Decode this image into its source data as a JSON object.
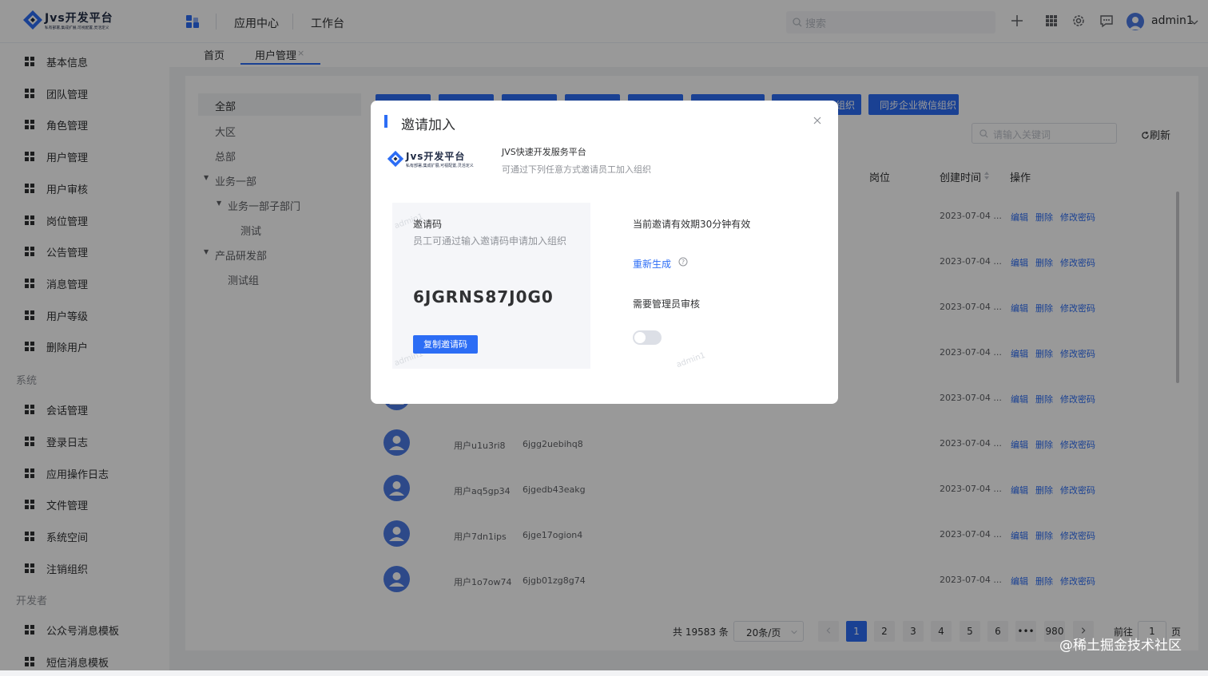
{
  "header": {
    "logo_title": "Jvs开发平台",
    "logo_sub": "私有部署,集成扩展,可视配置,灵活定义",
    "nav": [
      "应用中心",
      "工作台"
    ],
    "search_placeholder": "搜索",
    "user_name": "admin1"
  },
  "sidebar": {
    "items_top": [
      "基本信息",
      "团队管理",
      "角色管理",
      "用户管理",
      "用户审核",
      "岗位管理",
      "公告管理",
      "消息管理",
      "用户等级",
      "删除用户"
    ],
    "group_system": "系统",
    "items_system": [
      "会话管理",
      "登录日志",
      "应用操作日志",
      "文件管理",
      "系统空间",
      "注销组织"
    ],
    "group_dev": "开发者",
    "items_dev": [
      "公众号消息模板",
      "短信消息模板"
    ]
  },
  "tabs": {
    "home": "首页",
    "active": "用户管理",
    "close": "×"
  },
  "tree": {
    "items": [
      "全部",
      "大区",
      "总部",
      "业务一部",
      "业务一部子部门",
      "测试",
      "产品研发部",
      "测试组"
    ]
  },
  "toolbar": {
    "sync_label": "同步企业微信组织",
    "partial_label": "组织",
    "keyword_placeholder": "请输入关键词",
    "refresh_label": "刷新"
  },
  "table": {
    "headers": [
      "岗位",
      "创建时间",
      "操作"
    ],
    "actions": [
      "编辑",
      "删除",
      "修改密码"
    ],
    "time_text": "2023-07-04 ...",
    "rows": [
      {
        "name": "",
        "account": ""
      },
      {
        "name": "",
        "account": ""
      },
      {
        "name": "",
        "account": ""
      },
      {
        "name": "",
        "account": ""
      },
      {
        "name": "",
        "account": ""
      },
      {
        "name": "用户u1u3ri8",
        "account": "6jgg2uebihq8"
      },
      {
        "name": "用户aq5gp34",
        "account": "6jgedb43eakg"
      },
      {
        "name": "用户7dn1ips",
        "account": "6jge17ogion4"
      },
      {
        "name": "用户1o7ow74",
        "account": "6jgb01zg8g74"
      }
    ]
  },
  "pagination": {
    "total": "共 19583 条",
    "page_size": "20条/页",
    "pages": [
      "1",
      "2",
      "3",
      "4",
      "5",
      "6",
      "•••",
      "980"
    ],
    "goto_label": "前往",
    "goto_value": "1",
    "page_suffix": "页"
  },
  "modal": {
    "title": "邀请加入",
    "logo_title": "Jvs开发平台",
    "logo_sub": "私有部署,集成扩展,可视配置,灵活定义",
    "platform_name": "JVS快速开发服务平台",
    "description": "可通过下列任意方式邀请员工加入组织",
    "code_label": "邀请码",
    "code_hint": "员工可通过输入邀请码申请加入组织",
    "code_value": "6JGRNS87J0G0",
    "copy_button": "复制邀请码",
    "validity": "当前邀请有效期30分钟有效",
    "regenerate": "重新生成",
    "review_label": "需要管理员审核",
    "review_enabled": false,
    "watermark": "admin1"
  },
  "footer_watermark": "@稀土掘金技术社区",
  "colors": {
    "primary": "#2c6df5",
    "avatar": "#4b7be5"
  }
}
